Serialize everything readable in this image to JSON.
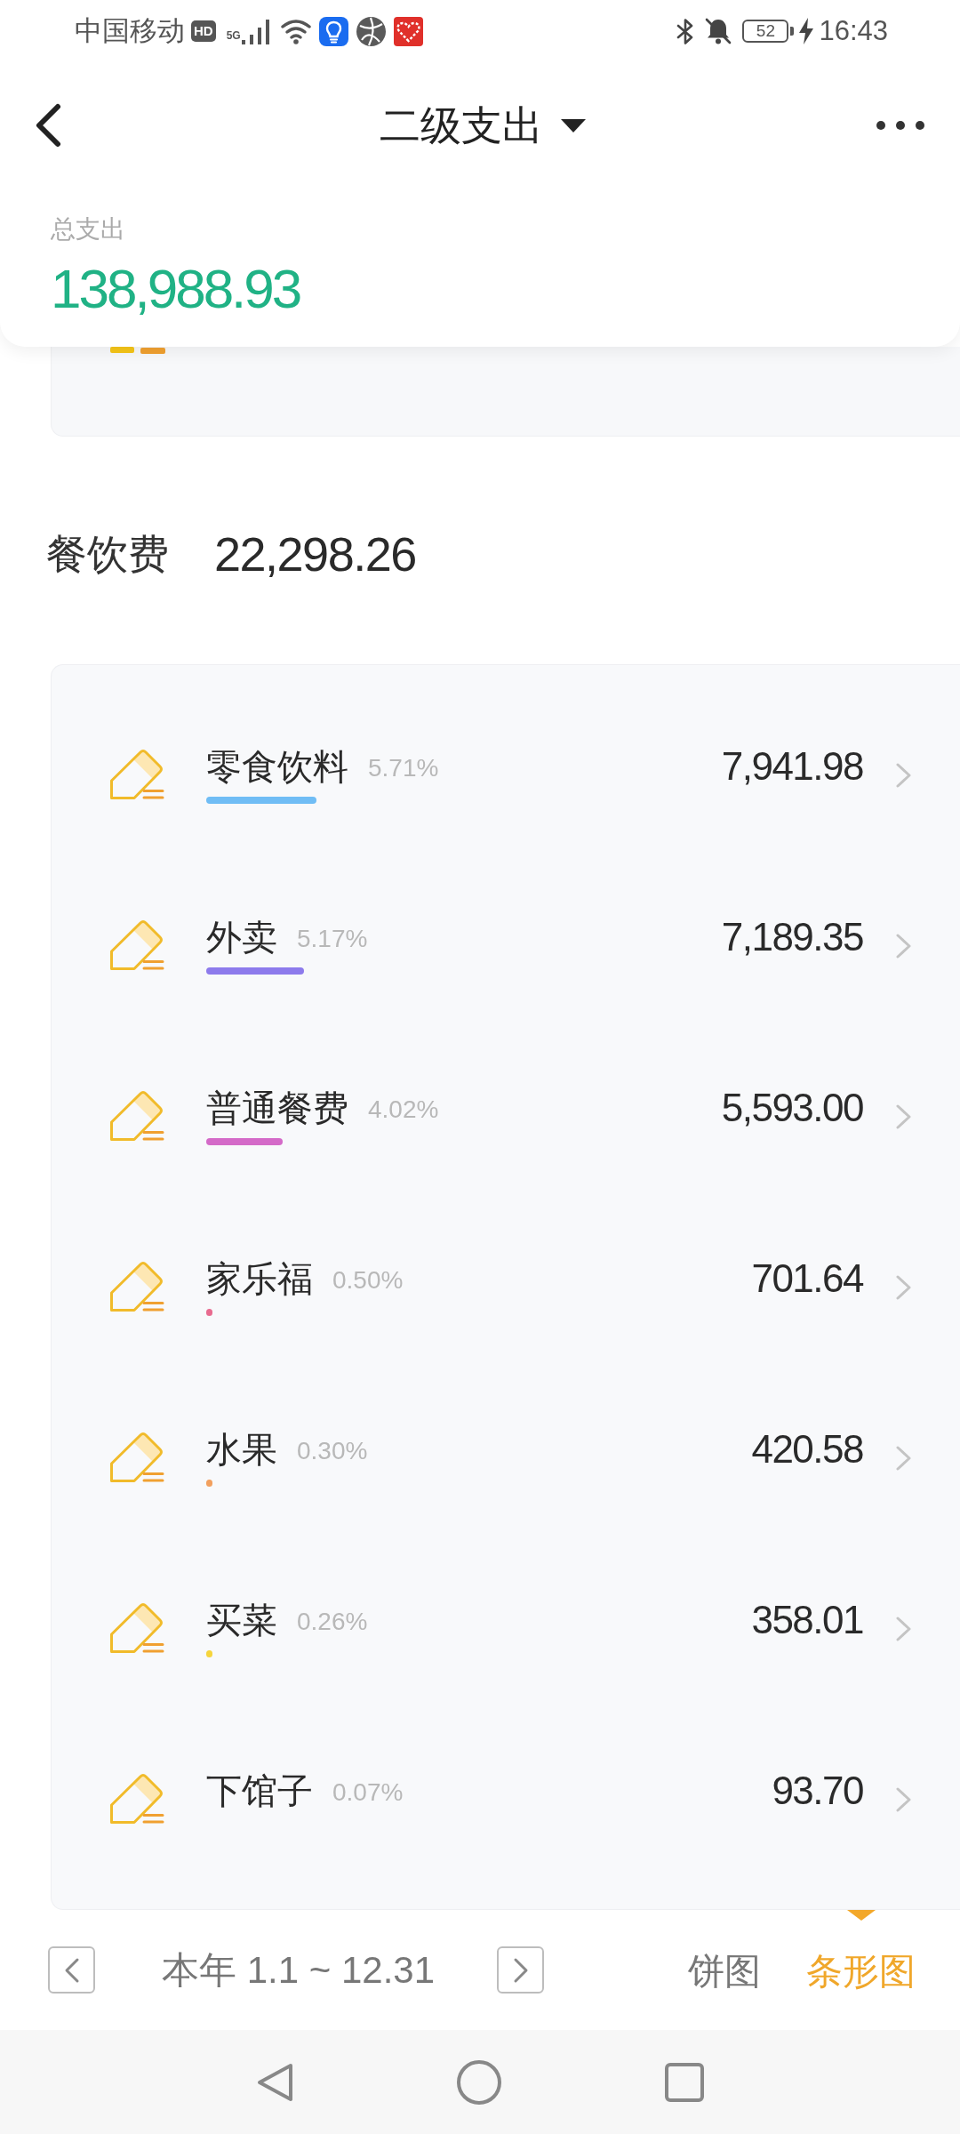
{
  "status_bar": {
    "carrier": "中国移动",
    "hd_badge": "HD",
    "network": "5G",
    "battery": "52",
    "time": "16:43"
  },
  "header": {
    "title": "二级支出"
  },
  "summary": {
    "label": "总支出",
    "amount": "138,988.93"
  },
  "category": {
    "name": "餐饮费",
    "amount": "22,298.26"
  },
  "items": [
    {
      "name": "零食饮料",
      "percent": "5.71%",
      "amount": "7,941.98",
      "level": 0.36,
      "color": "#70bdf5"
    },
    {
      "name": "外卖",
      "percent": "5.17%",
      "amount": "7,189.35",
      "level": 0.32,
      "color": "#8d7bec"
    },
    {
      "name": "普通餐费",
      "percent": "4.02%",
      "amount": "5,593.00",
      "level": 0.25,
      "color": "#d46ac8"
    },
    {
      "name": "家乐福",
      "percent": "0.50%",
      "amount": "701.64",
      "level": 0.02,
      "color": "#e86b8f"
    },
    {
      "name": "水果",
      "percent": "0.30%",
      "amount": "420.58",
      "level": 0.02,
      "color": "#f2a05e"
    },
    {
      "name": "买菜",
      "percent": "0.26%",
      "amount": "358.01",
      "level": 0.02,
      "color": "#f6d53c"
    },
    {
      "name": "下馆子",
      "percent": "0.07%",
      "amount": "93.70"
    }
  ],
  "footer": {
    "range": "本年 1.1 ~ 12.31",
    "views": [
      {
        "label": "饼图",
        "selected": false
      },
      {
        "label": "条形图",
        "selected": true
      }
    ]
  }
}
